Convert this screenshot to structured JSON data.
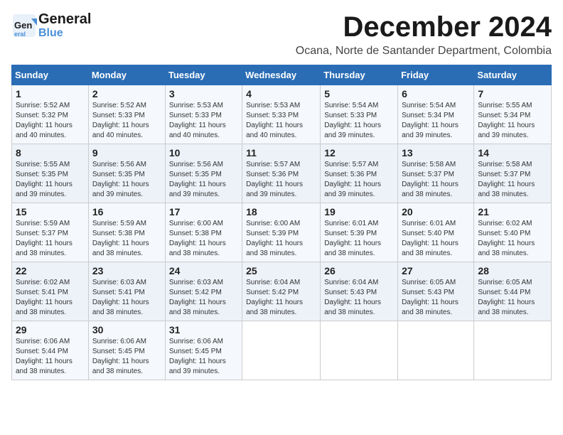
{
  "header": {
    "logo_general": "General",
    "logo_blue": "Blue",
    "month_title": "December 2024",
    "location": "Ocana, Norte de Santander Department, Colombia"
  },
  "weekdays": [
    "Sunday",
    "Monday",
    "Tuesday",
    "Wednesday",
    "Thursday",
    "Friday",
    "Saturday"
  ],
  "weeks": [
    [
      {
        "day": "1",
        "info": "Sunrise: 5:52 AM\nSunset: 5:32 PM\nDaylight: 11 hours\nand 40 minutes."
      },
      {
        "day": "2",
        "info": "Sunrise: 5:52 AM\nSunset: 5:33 PM\nDaylight: 11 hours\nand 40 minutes."
      },
      {
        "day": "3",
        "info": "Sunrise: 5:53 AM\nSunset: 5:33 PM\nDaylight: 11 hours\nand 40 minutes."
      },
      {
        "day": "4",
        "info": "Sunrise: 5:53 AM\nSunset: 5:33 PM\nDaylight: 11 hours\nand 40 minutes."
      },
      {
        "day": "5",
        "info": "Sunrise: 5:54 AM\nSunset: 5:33 PM\nDaylight: 11 hours\nand 39 minutes."
      },
      {
        "day": "6",
        "info": "Sunrise: 5:54 AM\nSunset: 5:34 PM\nDaylight: 11 hours\nand 39 minutes."
      },
      {
        "day": "7",
        "info": "Sunrise: 5:55 AM\nSunset: 5:34 PM\nDaylight: 11 hours\nand 39 minutes."
      }
    ],
    [
      {
        "day": "8",
        "info": "Sunrise: 5:55 AM\nSunset: 5:35 PM\nDaylight: 11 hours\nand 39 minutes."
      },
      {
        "day": "9",
        "info": "Sunrise: 5:56 AM\nSunset: 5:35 PM\nDaylight: 11 hours\nand 39 minutes."
      },
      {
        "day": "10",
        "info": "Sunrise: 5:56 AM\nSunset: 5:35 PM\nDaylight: 11 hours\nand 39 minutes."
      },
      {
        "day": "11",
        "info": "Sunrise: 5:57 AM\nSunset: 5:36 PM\nDaylight: 11 hours\nand 39 minutes."
      },
      {
        "day": "12",
        "info": "Sunrise: 5:57 AM\nSunset: 5:36 PM\nDaylight: 11 hours\nand 39 minutes."
      },
      {
        "day": "13",
        "info": "Sunrise: 5:58 AM\nSunset: 5:37 PM\nDaylight: 11 hours\nand 38 minutes."
      },
      {
        "day": "14",
        "info": "Sunrise: 5:58 AM\nSunset: 5:37 PM\nDaylight: 11 hours\nand 38 minutes."
      }
    ],
    [
      {
        "day": "15",
        "info": "Sunrise: 5:59 AM\nSunset: 5:37 PM\nDaylight: 11 hours\nand 38 minutes."
      },
      {
        "day": "16",
        "info": "Sunrise: 5:59 AM\nSunset: 5:38 PM\nDaylight: 11 hours\nand 38 minutes."
      },
      {
        "day": "17",
        "info": "Sunrise: 6:00 AM\nSunset: 5:38 PM\nDaylight: 11 hours\nand 38 minutes."
      },
      {
        "day": "18",
        "info": "Sunrise: 6:00 AM\nSunset: 5:39 PM\nDaylight: 11 hours\nand 38 minutes."
      },
      {
        "day": "19",
        "info": "Sunrise: 6:01 AM\nSunset: 5:39 PM\nDaylight: 11 hours\nand 38 minutes."
      },
      {
        "day": "20",
        "info": "Sunrise: 6:01 AM\nSunset: 5:40 PM\nDaylight: 11 hours\nand 38 minutes."
      },
      {
        "day": "21",
        "info": "Sunrise: 6:02 AM\nSunset: 5:40 PM\nDaylight: 11 hours\nand 38 minutes."
      }
    ],
    [
      {
        "day": "22",
        "info": "Sunrise: 6:02 AM\nSunset: 5:41 PM\nDaylight: 11 hours\nand 38 minutes."
      },
      {
        "day": "23",
        "info": "Sunrise: 6:03 AM\nSunset: 5:41 PM\nDaylight: 11 hours\nand 38 minutes."
      },
      {
        "day": "24",
        "info": "Sunrise: 6:03 AM\nSunset: 5:42 PM\nDaylight: 11 hours\nand 38 minutes."
      },
      {
        "day": "25",
        "info": "Sunrise: 6:04 AM\nSunset: 5:42 PM\nDaylight: 11 hours\nand 38 minutes."
      },
      {
        "day": "26",
        "info": "Sunrise: 6:04 AM\nSunset: 5:43 PM\nDaylight: 11 hours\nand 38 minutes."
      },
      {
        "day": "27",
        "info": "Sunrise: 6:05 AM\nSunset: 5:43 PM\nDaylight: 11 hours\nand 38 minutes."
      },
      {
        "day": "28",
        "info": "Sunrise: 6:05 AM\nSunset: 5:44 PM\nDaylight: 11 hours\nand 38 minutes."
      }
    ],
    [
      {
        "day": "29",
        "info": "Sunrise: 6:06 AM\nSunset: 5:44 PM\nDaylight: 11 hours\nand 38 minutes."
      },
      {
        "day": "30",
        "info": "Sunrise: 6:06 AM\nSunset: 5:45 PM\nDaylight: 11 hours\nand 38 minutes."
      },
      {
        "day": "31",
        "info": "Sunrise: 6:06 AM\nSunset: 5:45 PM\nDaylight: 11 hours\nand 39 minutes."
      },
      null,
      null,
      null,
      null
    ]
  ]
}
